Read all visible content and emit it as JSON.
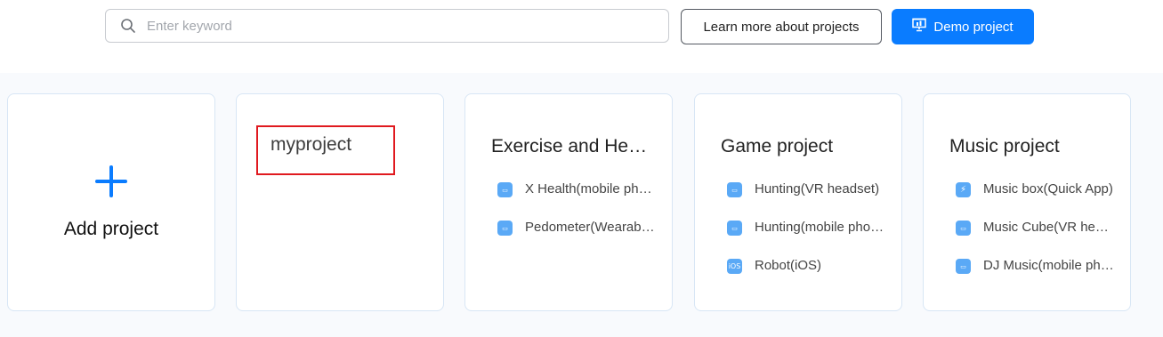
{
  "search": {
    "placeholder": "Enter keyword"
  },
  "toolbar": {
    "learn_more_label": "Learn more about projects",
    "demo_label": "Demo project"
  },
  "add_card": {
    "label": "Add project"
  },
  "cards": [
    {
      "title": "myproject",
      "items": []
    },
    {
      "title": "Exercise and Health",
      "items": [
        {
          "label": "X Health(mobile phone)",
          "icon": "harmony-app-icon"
        },
        {
          "label": "Pedometer(Wearable)",
          "icon": "harmony-app-icon"
        }
      ]
    },
    {
      "title": "Game project",
      "items": [
        {
          "label": "Hunting(VR headset)",
          "icon": "harmony-app-icon"
        },
        {
          "label": "Hunting(mobile phone)",
          "icon": "harmony-app-icon"
        },
        {
          "label": "Robot(iOS)",
          "icon": "ios-app-icon"
        }
      ]
    },
    {
      "title": "Music project",
      "items": [
        {
          "label": "Music box(Quick App)",
          "icon": "quick-app-icon"
        },
        {
          "label": "Music Cube(VR headset)",
          "icon": "harmony-app-icon"
        },
        {
          "label": "DJ Music(mobile phone)",
          "icon": "harmony-app-icon"
        }
      ]
    }
  ],
  "colors": {
    "primary": "#0a7cff",
    "highlight": "#e0191f",
    "icon_blue": "#5aa9f6"
  }
}
